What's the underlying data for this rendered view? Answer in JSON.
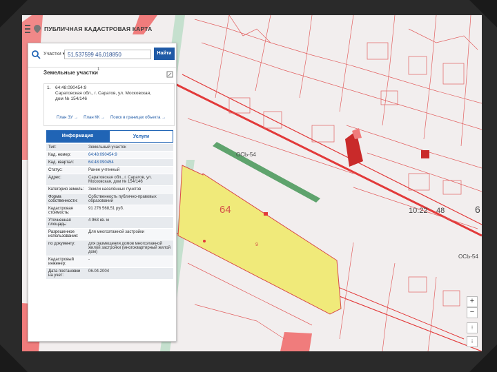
{
  "app": {
    "title": "ПУБЛИЧНАЯ КАДАСТРОВАЯ КАРТА"
  },
  "search": {
    "type_label": "Участки",
    "value": "51,537599 46,018850",
    "button": "Найти"
  },
  "results": {
    "title": "Земельные участки",
    "count": "1"
  },
  "object": {
    "index": "1.",
    "cad_number": "64:48:090454:9",
    "address": "Саратовская обл., г. Саратов, ул. Московская, дом № 154/146",
    "links": [
      "План ЗУ →",
      "План КК →",
      "Поиск в границах объекта →"
    ]
  },
  "tabs": [
    "Информация",
    "Услуги"
  ],
  "attributes": [
    {
      "key": "Тип:",
      "value": "Земельный участок",
      "link": false
    },
    {
      "key": "Кад. номер:",
      "value": "64:48:090454:9",
      "link": true
    },
    {
      "key": "Кад. квартал:",
      "value": "64:48:090454",
      "link": true
    },
    {
      "key": "Статус:",
      "value": "Ранее учтенный",
      "link": false
    },
    {
      "key": "Адрес:",
      "value": "Саратовская обл., г. Саратов, ул. Московская, дом № 154/146",
      "link": false
    },
    {
      "key": "Категория земель:",
      "value": "Земли населённых пунктов",
      "link": false
    },
    {
      "key": "Форма собственности:",
      "value": "Собственность публично-правовых образований",
      "link": false
    },
    {
      "key": "Кадастровая стоимость:",
      "value": "91 276 568,51 руб.",
      "link": false
    },
    {
      "key": "Уточненная площадь:",
      "value": "4 963 кв. м",
      "link": false
    },
    {
      "key": "Разрешенное использование:",
      "value": "Для многоэтажной застройки",
      "link": false
    },
    {
      "key": "по документу:",
      "value": "для размещения домов многоэтажной жилой застройки (многоквартирный жилой дом)",
      "link": false
    },
    {
      "key": "Кадастровый инженер:",
      "value": "-",
      "link": false
    },
    {
      "key": "Дата постановки на учет:",
      "value": "06.04.2004",
      "link": false
    }
  ],
  "map_labels": {
    "parcel": "64",
    "parcel_small": "9",
    "road_a": "ОСЬ-54",
    "road_b": "ОСЬ-54",
    "block_a": "10:22",
    "block_b": "48",
    "block_c": "6"
  },
  "map_controls": {
    "zoom_in": "+",
    "zoom_out": "−"
  },
  "colors": {
    "accent": "#2064b5",
    "parcel_fill": "#f0ea7a",
    "boundary": "#e23a3a",
    "green_band": "#5fa36d"
  }
}
